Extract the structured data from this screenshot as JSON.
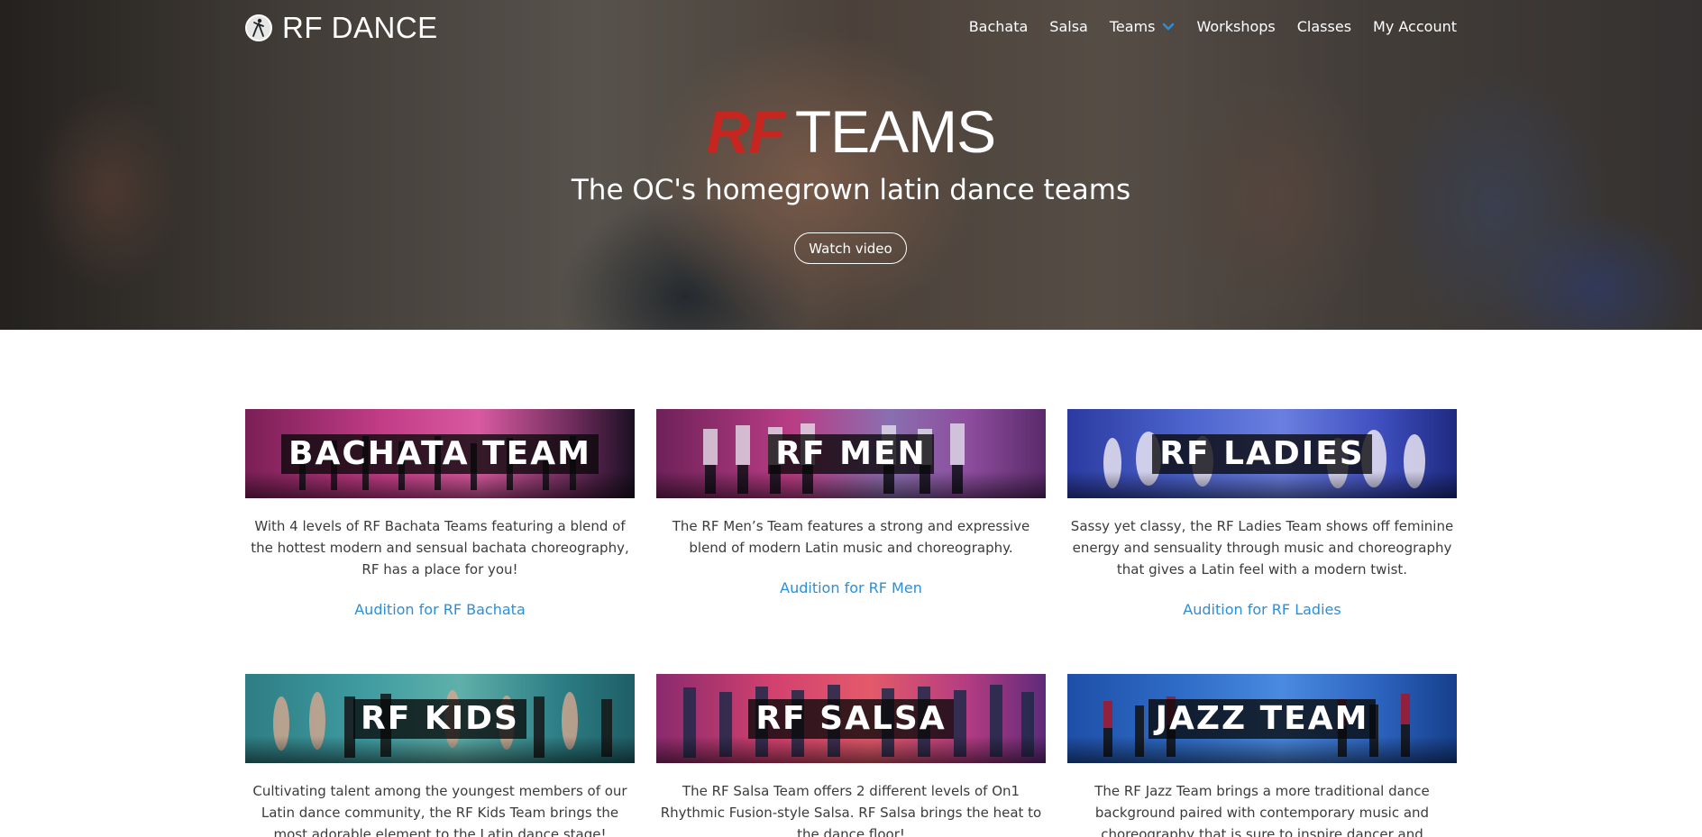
{
  "header": {
    "logo_text": "RF DANCE",
    "logo_icon": "dancer-logo-icon",
    "nav": [
      {
        "label": "Bachata"
      },
      {
        "label": "Salsa"
      },
      {
        "label": "Teams",
        "icon": "chevron-down-icon"
      },
      {
        "label": "Workshops"
      },
      {
        "label": "Classes"
      },
      {
        "label": "My Account"
      }
    ],
    "chevron_color": "#2a8fd8"
  },
  "hero": {
    "title_accent": "RF",
    "title_rest": "TEAMS",
    "subtitle": "The OC's homegrown latin dance teams",
    "button": "Watch video",
    "accent_color": "#c7251f"
  },
  "teams": [
    {
      "banner": "BACHATA TEAM",
      "description": "With 4 levels of RF Bachata Teams featuring a blend of the hottest modern and sensual bachata choreography, RF has a place for you!",
      "link": "Audition for RF Bachata"
    },
    {
      "banner": "RF MEN",
      "description": "The RF Men’s Team features a strong and expressive blend of modern Latin music and choreography.",
      "link": "Audition for RF Men"
    },
    {
      "banner": "RF LADIES",
      "description": "Sassy yet classy, the RF Ladies Team shows off feminine energy and sensuality through music and choreography that gives a Latin feel with a modern twist.",
      "link": "Audition for RF Ladies"
    },
    {
      "banner": "RF KIDS",
      "description": "Cultivating talent among the youngest members of our Latin dance community, the RF Kids Team brings the most adorable element to the Latin dance stage!"
    },
    {
      "banner": "RF SALSA",
      "description": "The RF Salsa Team offers 2 different levels of On1 Rhythmic Fusion-style Salsa. RF Salsa brings the heat to the dance floor!"
    },
    {
      "banner": "JAZZ TEAM",
      "description": "The RF Jazz Team brings a more traditional dance background paired with contemporary music and choreography that is sure to inspire dancer and spectator"
    }
  ],
  "link_color": "#2a8fd8"
}
